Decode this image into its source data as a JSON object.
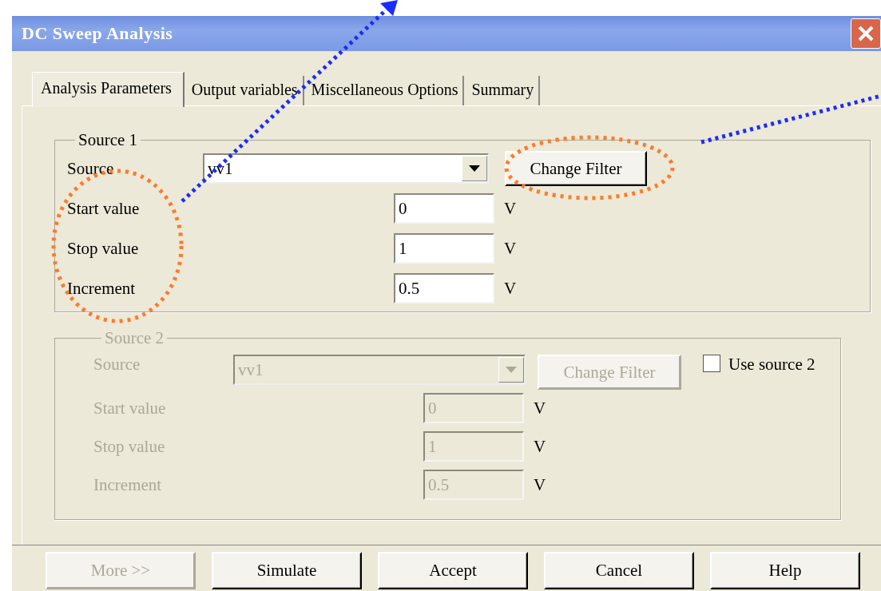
{
  "window": {
    "title": "DC Sweep Analysis"
  },
  "tabs": [
    {
      "label": "Analysis Parameters",
      "selected": true
    },
    {
      "label": "Output variables",
      "selected": false
    },
    {
      "label": "Miscellaneous Options",
      "selected": false
    },
    {
      "label": "Summary",
      "selected": false
    }
  ],
  "source_groups": [
    {
      "title": "Source 1",
      "disabled": false,
      "source_label": "Source",
      "source_value": "vv1",
      "filter_button": "Change Filter",
      "fields": [
        {
          "label": "Start value",
          "value": "0",
          "unit": "V"
        },
        {
          "label": "Stop value",
          "value": "1",
          "unit": "V"
        },
        {
          "label": "Increment",
          "value": "0.5",
          "unit": "V"
        }
      ]
    },
    {
      "title": "Source 2",
      "disabled": true,
      "source_label": "Source",
      "source_value": "vv1",
      "filter_button": "Change Filter",
      "checkbox": {
        "label": "Use source 2",
        "checked": false
      },
      "fields": [
        {
          "label": "Start value",
          "value": "0",
          "unit": "V"
        },
        {
          "label": "Stop value",
          "value": "1",
          "unit": "V"
        },
        {
          "label": "Increment",
          "value": "0.5",
          "unit": "V"
        }
      ]
    }
  ],
  "buttons": [
    {
      "label": "More >>",
      "disabled": true
    },
    {
      "label": "Simulate",
      "disabled": false
    },
    {
      "label": "Accept",
      "disabled": false
    },
    {
      "label": "Cancel",
      "disabled": false
    },
    {
      "label": "Help",
      "disabled": false
    }
  ]
}
